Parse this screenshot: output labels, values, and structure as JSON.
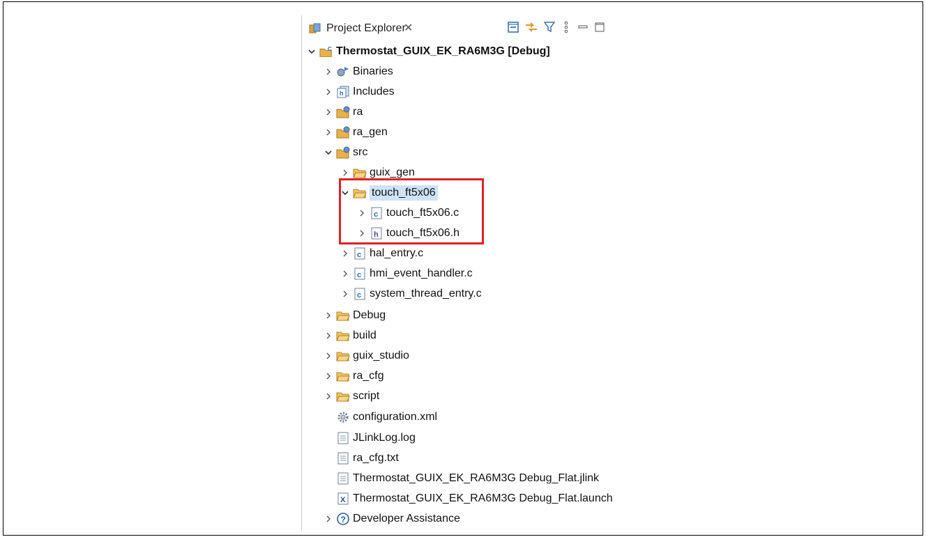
{
  "panel": {
    "tab_label": "Project Explorer",
    "tab_close": "✕",
    "toolbar": [
      {
        "name": "collapse-all-icon"
      },
      {
        "name": "link-with-editor-icon"
      },
      {
        "name": "filter-icon"
      },
      {
        "name": "view-menu-icon"
      },
      {
        "name": "minimize-icon"
      },
      {
        "name": "maximize-icon"
      }
    ]
  },
  "tree": {
    "project": "Thermostat_GUIX_EK_RA6M3G [Debug]",
    "binaries": "Binaries",
    "includes": "Includes",
    "ra": "ra",
    "ra_gen": "ra_gen",
    "src": "src",
    "guix_gen": "guix_gen",
    "touch_ft5x06": "touch_ft5x06",
    "touch_c": "touch_ft5x06.c",
    "touch_h": "touch_ft5x06.h",
    "hal_entry": "hal_entry.c",
    "hmi_event_handler": "hmi_event_handler.c",
    "system_thread_entry": "system_thread_entry.c",
    "debug": "Debug",
    "build": "build",
    "guix_studio": "guix_studio",
    "ra_cfg": "ra_cfg",
    "script": "script",
    "configuration_xml": "configuration.xml",
    "jlinklog": "JLinkLog.log",
    "ra_cfg_txt": "ra_cfg.txt",
    "flat_jlink": "Thermostat_GUIX_EK_RA6M3G Debug_Flat.jlink",
    "flat_launch": "Thermostat_GUIX_EK_RA6M3G Debug_Flat.launch",
    "developer_assistance": "Developer Assistance"
  },
  "colors": {
    "folder": "#e8b24a",
    "selection": "#cfe3f7",
    "highlight_border": "#e0202a",
    "c_file": "#1f6fb3"
  }
}
